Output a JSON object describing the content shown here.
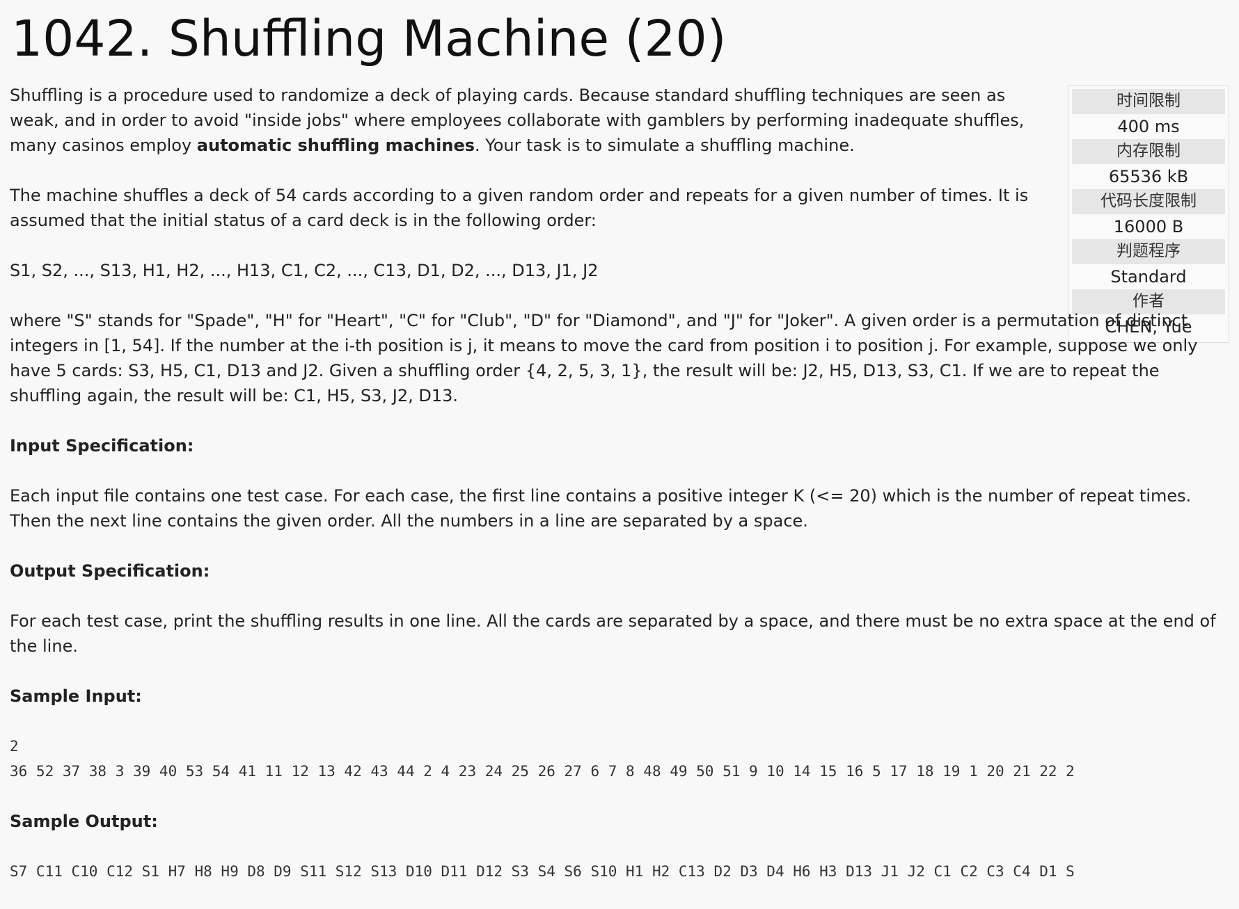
{
  "problem": {
    "title": "1042. Shuffling Machine (20)"
  },
  "limits": [
    {
      "label": "时间限制",
      "value": "400 ms"
    },
    {
      "label": "内存限制",
      "value": "65536 kB"
    },
    {
      "label": "代码长度限制",
      "value": "16000 B"
    },
    {
      "label": "判题程序",
      "value": "Standard"
    },
    {
      "label": "作者",
      "value": "CHEN, Yue"
    }
  ],
  "description": {
    "p1_before": "Shuffling is a procedure used to randomize a deck of playing cards. Because standard shuffling techniques are seen as weak, and in order to avoid \"inside jobs\" where employees collaborate with gamblers by performing inadequate shuffles, many casinos employ ",
    "p1_bold": "automatic shuffling machines",
    "p1_after": ". Your task is to simulate a shuffling machine.",
    "p2": "The machine shuffles a deck of 54 cards according to a given random order and repeats for a given number of times. It is assumed that the initial status of a card deck is in the following order:",
    "p3": "S1, S2, ..., S13, H1, H2, ..., H13, C1, C2, ..., C13, D1, D2, ..., D13, J1, J2",
    "p4": "where \"S\" stands for \"Spade\", \"H\" for \"Heart\", \"C\" for \"Club\", \"D\" for \"Diamond\", and \"J\" for \"Joker\". A given order is a permutation of distinct integers in [1, 54]. If the number at the i-th position is j, it means to move the card from position i to position j. For example, suppose we only have 5 cards: S3, H5, C1, D13 and J2. Given a shuffling order {4, 2, 5, 3, 1}, the result will be: J2, H5, D13, S3, C1. If we are to repeat the shuffling again, the result will be: C1, H5, S3, J2, D13."
  },
  "input_spec": {
    "heading": "Input Specification:",
    "text": "Each input file contains one test case. For each case, the first line contains a positive integer K (<= 20) which is the number of repeat times. Then the next line contains the given order. All the numbers in a line are separated by a space."
  },
  "output_spec": {
    "heading": "Output Specification:",
    "text": "For each test case, print the shuffling results in one line. All the cards are separated by a space, and there must be no extra space at the end of the line."
  },
  "sample_input": {
    "heading": "Sample Input:",
    "line1": "2",
    "line2": "36 52 37 38 3 39 40 53 54 41 11 12 13 42 43 44 2 4 23 24 25 26 27 6 7 8 48 49 50 51 9 10 14 15 16 5 17 18 19 1 20 21 22 2"
  },
  "sample_output": {
    "heading": "Sample Output:",
    "line1": "S7 C11 C10 C12 S1 H7 H8 H9 D8 D9 S11 S12 S13 D10 D11 D12 S3 S4 S6 S10 H1 H2 C13 D2 D3 D4 H6 H3 D13 J1 J2 C1 C2 C3 C4 D1 S"
  }
}
